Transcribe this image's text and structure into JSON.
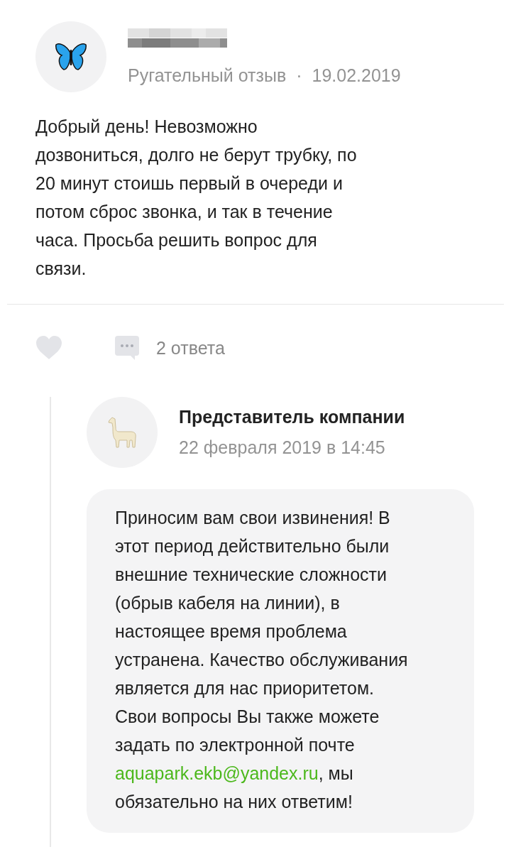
{
  "review": {
    "author_redacted": true,
    "type": "Ругательный отзыв",
    "separator": "·",
    "date": "19.02.2019",
    "text": "Добрый день! Невозможно дозвониться, долго не берут трубку, по 20 минут стоишь первый в очереди и потом сброс звонка, и так в течение часа. Просьба решить вопрос для связи.",
    "liked": false,
    "replies_label": "2 ответа"
  },
  "reply": {
    "author": "Представитель компании",
    "date": "22 февраля 2019 в 14:45",
    "text_before": "Приносим вам свои извинения! В этот период действительно были внешние технические сложности (обрыв кабеля на линии), в настоящее время проблема устранена. Качество обслуживания является для нас приоритетом. Свои вопросы Вы также можете задать по электронной почте ",
    "link": "aquapark.ekb@yandex.ru",
    "text_after": ", мы обязательно на них ответим!"
  }
}
